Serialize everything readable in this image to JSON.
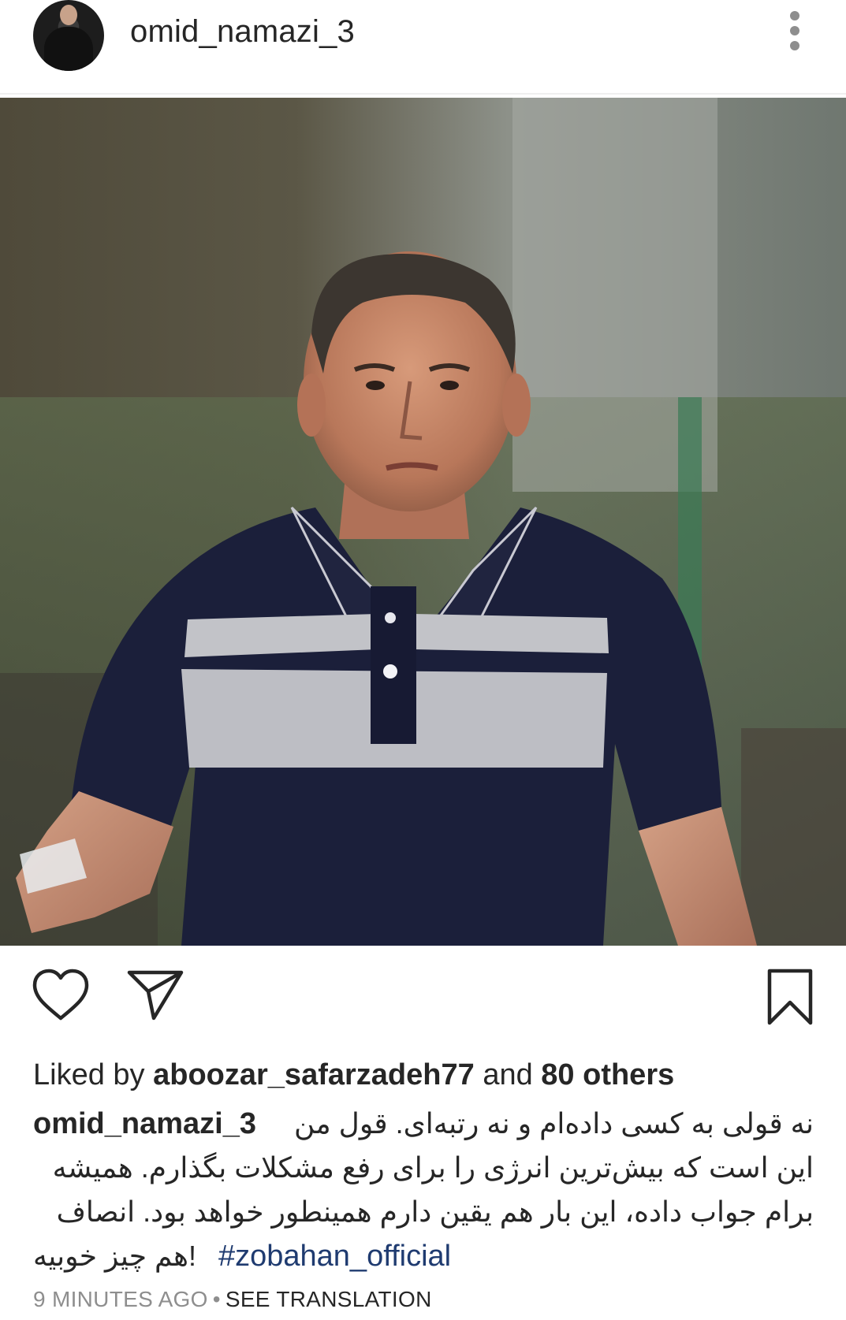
{
  "header": {
    "username": "omid_namazi_3",
    "avatar_icon": "user-avatar",
    "more_icon": "vertical-ellipsis-icon"
  },
  "post": {
    "image_icon": "photo",
    "actions": {
      "like_icon": "heart-outline-icon",
      "share_icon": "paper-plane-icon",
      "save_icon": "bookmark-outline-icon"
    },
    "likes": {
      "prefix": "Liked by",
      "user": "aboozar_safarzadeh77",
      "middle": "and",
      "count_text": "80 others"
    },
    "caption": {
      "username": "omid_namazi_3",
      "line1": "نه قولی به کسی داده‌ام و نه رتبه‌ای. قول من",
      "line2": "این است که بیش‌ترین انرژی را برای رفع مشکلات بگذارم. همیشه",
      "line3": "برام جواب داده، این بار هم یقین دارم همینطور خواهد بود. انصاف",
      "line4": "!هم چیز خوبیه",
      "hashtag": "#zobahan_official"
    },
    "timestamp": "9 MINUTES AGO",
    "separator": "•",
    "see_translation": "SEE TRANSLATION"
  },
  "colors": {
    "text": "#262626",
    "muted": "#8e8e8e",
    "hashtag": "#1f3b70",
    "divider": "#efefef"
  }
}
